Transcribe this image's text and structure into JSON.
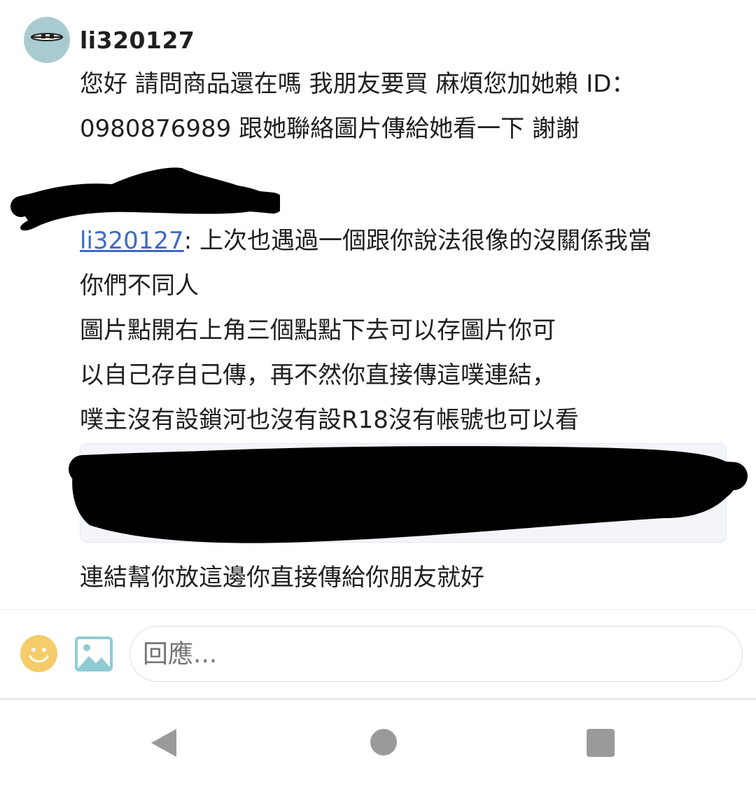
{
  "comment": {
    "username": "li320127",
    "avatar_icon": "sleepy-face-avatar",
    "message": [
      "您好 請問商品還在嗎 我朋友要買 麻煩您加她賴 ID：",
      "0980876989 跟她聯絡圖片傳給她看一下 謝謝"
    ]
  },
  "reply": {
    "mention": "li320127",
    "mention_suffix": ": 上次也遇過一個跟你說法很像的沒關係我當",
    "lines": [
      "你們不同人",
      "圖片點開右上角三個點點下去可以存圖片你可",
      "以自己存自己傳，再不然你直接傳這噗連結，",
      "噗主沒有設鎖河也沒有設R18沒有帳號也可以看"
    ],
    "after_link": "連結幫你放這邊你直接傳給你朋友就好"
  },
  "composer": {
    "placeholder": "回應...",
    "emoji_icon": "smiley-icon",
    "image_icon": "image-icon"
  },
  "navbar": {
    "back_icon": "back-triangle-icon",
    "home_icon": "home-circle-icon",
    "recent_icon": "recent-apps-square-icon"
  },
  "colors": {
    "mention": "#3d69c5",
    "avatar_bg": "#a9cbd0",
    "emoji": "#f6cc6a",
    "image_icon": "#8fcbd3"
  }
}
